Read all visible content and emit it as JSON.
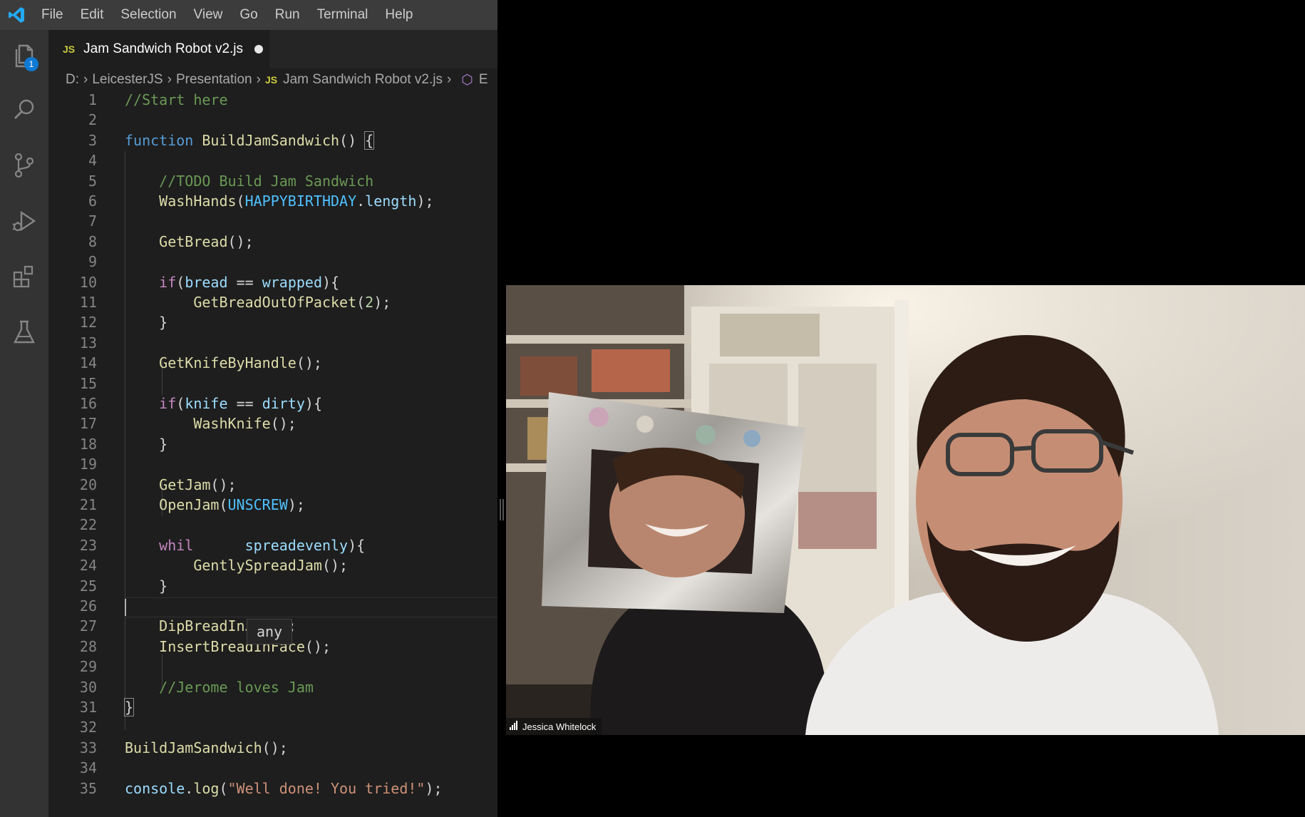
{
  "menu": {
    "items": [
      "File",
      "Edit",
      "Selection",
      "View",
      "Go",
      "Run",
      "Terminal",
      "Help"
    ]
  },
  "activity": {
    "explorer_badge": "1",
    "icons": [
      "files-icon",
      "search-icon",
      "source-control-icon",
      "run-debug-icon",
      "extensions-icon",
      "testing-icon"
    ]
  },
  "tab": {
    "lang_badge": "JS",
    "filename": "Jam Sandwich Robot v2.js"
  },
  "breadcrumb": {
    "drive": "D:",
    "folder1": "LeicesterJS",
    "folder2": "Presentation",
    "lang_badge": "JS",
    "file": "Jam Sandwich Robot v2.js",
    "symbol": "E"
  },
  "hover_tooltip": "any",
  "code": {
    "l1": "//Start here",
    "l3a": "function",
    "l3b": "BuildJamSandwich",
    "l3c": "() ",
    "l3d": "{",
    "l5": "//TODO Build Jam Sandwich",
    "l6a": "WashHands",
    "l6b": "(",
    "l6c": "HAPPYBIRTHDAY",
    "l6d": ".",
    "l6e": "length",
    "l6f": ");",
    "l8a": "GetBread",
    "l8b": "();",
    "l10a": "if",
    "l10b": "(",
    "l10c": "bread",
    "l10d": " == ",
    "l10e": "wrapped",
    "l10f": "){",
    "l11a": "GetBreadOutOfPacket",
    "l11b": "(",
    "l11c": "2",
    "l11d": ");",
    "l12": "}",
    "l14a": "GetKnifeByHandle",
    "l14b": "();",
    "l16a": "if",
    "l16b": "(",
    "l16c": "knife",
    "l16d": " == ",
    "l16e": "dirty",
    "l16f": "){",
    "l17a": "WashKnife",
    "l17b": "();",
    "l18": "}",
    "l20a": "GetJam",
    "l20b": "();",
    "l21a": "OpenJam",
    "l21b": "(",
    "l21c": "UNSCREW",
    "l21d": ");",
    "l23a": "whil",
    "l23b": "spreadevenly",
    "l23c": "){",
    "l24a": "GentlySpreadJam",
    "l24b": "();",
    "l25": "}",
    "l27a": "DipBreadInJam",
    "l27b": "();",
    "l28a": "InsertBreadInFace",
    "l28b": "();",
    "l30": "//Jerome loves Jam",
    "l31": "}",
    "l33a": "BuildJamSandwich",
    "l33b": "();",
    "l35a": "console",
    "l35b": ".",
    "l35c": "log",
    "l35d": "(",
    "l35e": "\"Well done! You tried!\"",
    "l35f": ");"
  },
  "line_numbers": [
    "1",
    "2",
    "3",
    "4",
    "5",
    "6",
    "7",
    "8",
    "9",
    "10",
    "11",
    "12",
    "13",
    "14",
    "15",
    "16",
    "17",
    "18",
    "19",
    "20",
    "21",
    "22",
    "23",
    "24",
    "25",
    "26",
    "27",
    "28",
    "29",
    "30",
    "31",
    "32",
    "33",
    "34",
    "35"
  ],
  "video": {
    "participant": "Jessica Whitelock"
  }
}
